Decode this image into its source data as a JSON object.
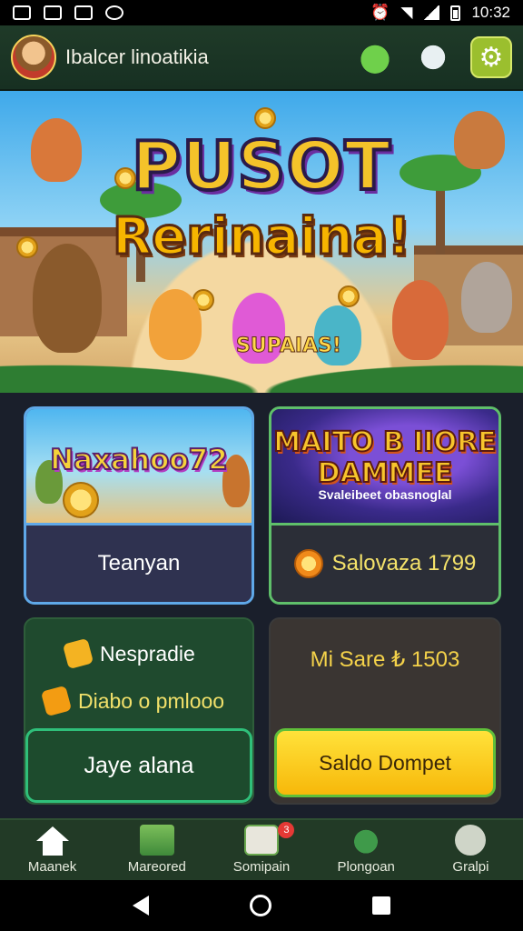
{
  "status_bar": {
    "time": "10:32"
  },
  "header": {
    "title": "Ibalcer linoatikia"
  },
  "banner": {
    "title": "PUSOT",
    "subtitle": "Rerinaina!",
    "tagline": "SUPAIAS!"
  },
  "cards": {
    "game_left": {
      "art_title": "Naxahoo72",
      "label": "Teanyan"
    },
    "game_right": {
      "art_title_line1": "MAITO B IIORE",
      "art_title_line2": "DAMMEE",
      "art_subtitle": "Svaleibeet obasnoglal",
      "balance": "Salovaza 1799"
    },
    "promo": {
      "row1": "Nespradie",
      "row2": "Diabo o pmlooo",
      "button": "Jaye alana"
    },
    "wallet": {
      "stat": "Mi Sare ₺ 1503",
      "button": "Saldo Dompet"
    }
  },
  "bottom_nav": {
    "items": [
      {
        "label": "Maanek",
        "icon": "home-icon"
      },
      {
        "label": "Mareored",
        "icon": "map-icon"
      },
      {
        "label": "Somipain",
        "icon": "shop-icon",
        "badge": "3"
      },
      {
        "label": "Plongoan",
        "icon": "frog-icon"
      },
      {
        "label": "Gralpi",
        "icon": "smile-icon"
      }
    ]
  }
}
